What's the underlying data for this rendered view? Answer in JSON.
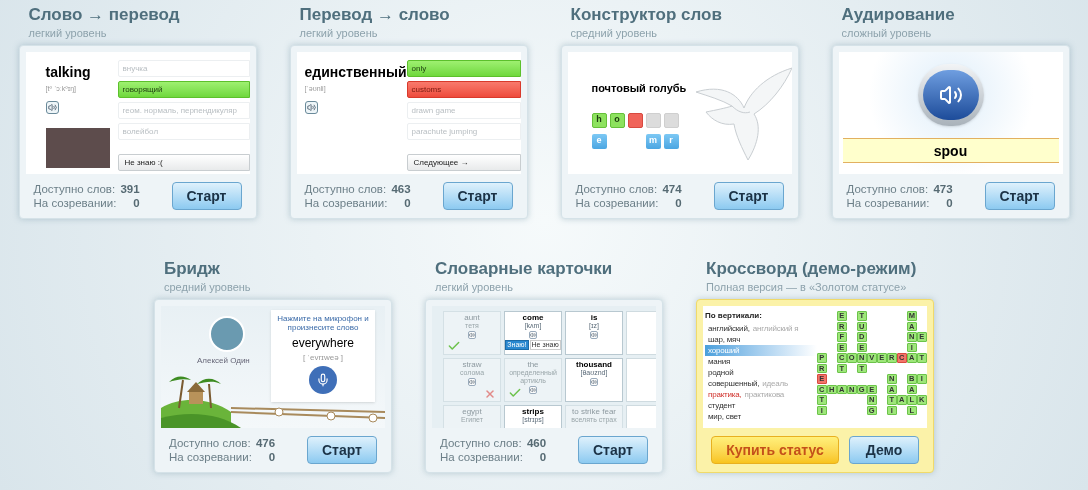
{
  "rows": [
    {
      "cards": [
        {
          "kind": "translate",
          "title": "Слово → перевод",
          "subtitle": "легкий уровень",
          "featured": false,
          "preview": {
            "word": "talking",
            "transcription": "[tº ˈɔːkºɪŋ]",
            "options": [
              {
                "text": "внучка",
                "correct": false,
                "wrong": false
              },
              {
                "text": "говорящий",
                "correct": true,
                "wrong": false
              },
              {
                "text": "геом. нормаль, перпендикуляр",
                "correct": false,
                "wrong": false
              },
              {
                "text": "волейбол",
                "correct": false,
                "wrong": false
              }
            ],
            "action": "Не знаю :("
          },
          "stats": [
            {
              "label": "Доступно слов:",
              "value": "391"
            },
            {
              "label": "На созревании:",
              "value": "0"
            }
          ],
          "buttons": [
            {
              "kind": "start",
              "label": "Старт"
            }
          ]
        },
        {
          "kind": "reverse",
          "title": "Перевод → слово",
          "subtitle": "легкий уровень",
          "featured": false,
          "preview": {
            "word": "единственный",
            "transcription": "[ˈəʊnli]",
            "options": [
              {
                "text": "only",
                "correct": true,
                "wrong": false
              },
              {
                "text": "customs",
                "correct": false,
                "wrong": true
              },
              {
                "text": "drawn game",
                "correct": false,
                "wrong": false
              },
              {
                "text": "parachute jumping",
                "correct": false,
                "wrong": false
              }
            ],
            "action": "Следующее →"
          },
          "stats": [
            {
              "label": "Доступно слов:",
              "value": "463"
            },
            {
              "label": "На созревании:",
              "value": "0"
            }
          ],
          "buttons": [
            {
              "kind": "start",
              "label": "Старт"
            }
          ]
        },
        {
          "kind": "constructor",
          "title": "Конструктор слов",
          "subtitle": "средний уровень",
          "featured": false,
          "preview": {
            "word": "почтовый голубь",
            "slots": [
              {
                "letter": "h",
                "correct": true,
                "wrong": false
              },
              {
                "letter": "o",
                "correct": true,
                "wrong": false
              },
              {
                "correct": false,
                "wrong": true
              },
              {
                "correct": false,
                "wrong": false
              },
              {
                "correct": false,
                "wrong": false
              }
            ],
            "tiles": [
              {
                "letter": "e",
                "used": false
              },
              {
                "used": true
              },
              {
                "used": true
              },
              {
                "letter": "m",
                "used": false
              },
              {
                "letter": "r",
                "used": false
              }
            ]
          },
          "stats": [
            {
              "label": "Доступно слов:",
              "value": "474"
            },
            {
              "label": "На созревании:",
              "value": "0"
            }
          ],
          "buttons": [
            {
              "kind": "start",
              "label": "Старт"
            }
          ]
        },
        {
          "kind": "listening",
          "title": "Аудирование",
          "subtitle": "сложный уровень",
          "featured": false,
          "preview": {
            "typed": "spou"
          },
          "stats": [
            {
              "label": "Доступно слов:",
              "value": "473"
            },
            {
              "label": "На созревании:",
              "value": "0"
            }
          ],
          "buttons": [
            {
              "kind": "start",
              "label": "Старт"
            }
          ]
        }
      ]
    },
    {
      "cards": [
        {
          "kind": "bridge",
          "title": "Бридж",
          "subtitle": "средний уровень",
          "featured": false,
          "preview": {
            "name": "Алексей Один",
            "prompt": "Нажмите на микрофон и произнесите слово",
            "word": "everywhere",
            "transcription": "[ ˈevrɪweə ]"
          },
          "stats": [
            {
              "label": "Доступно слов:",
              "value": "476"
            },
            {
              "label": "На созревании:",
              "value": "0"
            }
          ],
          "buttons": [
            {
              "kind": "start",
              "label": "Старт"
            }
          ]
        },
        {
          "kind": "flashcards",
          "title": "Словарные карточки",
          "subtitle": "легкий уровень",
          "featured": false,
          "preview": {
            "cards": [
              {
                "kind": "word",
                "word": "aunt",
                "hint": "тетя",
                "faded": true,
                "audio": true,
                "checked": true,
                "crossed": false
              },
              {
                "kind": "word",
                "word": "come",
                "hint": "[kʌm]",
                "faded": false,
                "audio": true,
                "checked": false,
                "crossed": false,
                "answers": [
                  {
                    "text": "Знаю!",
                    "selected": true
                  },
                  {
                    "text": "Не знаю",
                    "selected": false
                  }
                ]
              },
              {
                "kind": "word",
                "word": "is",
                "hint": "[ɪz]",
                "faded": false,
                "audio": true,
                "checked": false,
                "crossed": false
              },
              {
                "kind": "blank"
              },
              {
                "kind": "word",
                "word": "straw",
                "hint": "солома",
                "faded": true,
                "audio": true,
                "checked": false,
                "crossed": true
              },
              {
                "kind": "word",
                "word": "the",
                "hint": "определенный артикль",
                "faded": true,
                "audio": true,
                "checked": true,
                "crossed": false
              },
              {
                "kind": "word",
                "word": "thousand",
                "hint": "[θaʊznd]",
                "faded": false,
                "audio": true,
                "checked": false,
                "crossed": false
              },
              {
                "kind": "blank"
              },
              {
                "kind": "word",
                "word": "egypt",
                "hint": "Египет",
                "faded": true,
                "audio": false,
                "checked": false,
                "crossed": false
              },
              {
                "kind": "word",
                "word": "strips",
                "hint": "[strɪps]",
                "faded": false,
                "audio": false,
                "checked": false,
                "crossed": false
              },
              {
                "kind": "word",
                "word": "to strike fear",
                "hint": "вселять страх",
                "faded": true,
                "audio": false,
                "checked": false,
                "crossed": false
              },
              {
                "kind": "blank"
              }
            ]
          },
          "stats": [
            {
              "label": "Доступно слов:",
              "value": "460"
            },
            {
              "label": "На созревании:",
              "value": "0"
            }
          ],
          "buttons": [
            {
              "kind": "start",
              "label": "Старт"
            }
          ]
        },
        {
          "kind": "crossword",
          "title": "Кроссворд (демо-режим)",
          "subtitle": "Полная версия — в «Золотом статусе»",
          "featured": true,
          "preview": {
            "heading": "По вертикали:",
            "clues": [
              {
                "text": "английский,",
                "extra": "английский я",
                "selected": false,
                "wrong": false
              },
              {
                "text": "шар, мяч",
                "selected": false,
                "wrong": false
              },
              {
                "text": "хороший",
                "selected": true,
                "wrong": false
              },
              {
                "text": "мания",
                "selected": false,
                "wrong": false
              },
              {
                "text": "родной",
                "selected": false,
                "wrong": false
              },
              {
                "text": "совершенный,",
                "extra": "идеаль",
                "selected": false,
                "wrong": false
              },
              {
                "text": "практика,",
                "extra": "практикова",
                "selected": false,
                "wrong": true
              },
              {
                "text": "студент",
                "selected": false,
                "wrong": false
              },
              {
                "text": "мир, свет",
                "selected": false,
                "wrong": false
              }
            ],
            "grid": [
              [
                {
                  "kind": "empty"
                },
                {
                  "kind": "empty"
                },
                {
                  "kind": "letter",
                  "letter": "E",
                  "wrong": false
                },
                {
                  "kind": "empty"
                },
                {
                  "kind": "letter",
                  "letter": "T",
                  "wrong": false
                },
                {
                  "kind": "empty"
                },
                {
                  "kind": "empty"
                },
                {
                  "kind": "empty"
                },
                {
                  "kind": "empty"
                },
                {
                  "kind": "letter",
                  "letter": "M",
                  "wrong": false
                },
                {
                  "kind": "empty"
                }
              ],
              [
                {
                  "kind": "empty"
                },
                {
                  "kind": "empty"
                },
                {
                  "kind": "letter",
                  "letter": "R",
                  "wrong": false
                },
                {
                  "kind": "empty"
                },
                {
                  "kind": "letter",
                  "letter": "U",
                  "wrong": false
                },
                {
                  "kind": "empty"
                },
                {
                  "kind": "empty"
                },
                {
                  "kind": "empty"
                },
                {
                  "kind": "empty"
                },
                {
                  "kind": "letter",
                  "letter": "A",
                  "wrong": false
                },
                {
                  "kind": "empty"
                }
              ],
              [
                {
                  "kind": "empty"
                },
                {
                  "kind": "empty"
                },
                {
                  "kind": "letter",
                  "letter": "F",
                  "wrong": false
                },
                {
                  "kind": "empty"
                },
                {
                  "kind": "letter",
                  "letter": "D",
                  "wrong": false
                },
                {
                  "kind": "empty"
                },
                {
                  "kind": "empty"
                },
                {
                  "kind": "empty"
                },
                {
                  "kind": "empty"
                },
                {
                  "kind": "letter",
                  "letter": "N",
                  "wrong": false
                },
                {
                  "kind": "letter",
                  "letter": "E",
                  "wrong": false
                }
              ],
              [
                {
                  "kind": "empty"
                },
                {
                  "kind": "empty"
                },
                {
                  "kind": "letter",
                  "letter": "E",
                  "wrong": false
                },
                {
                  "kind": "empty"
                },
                {
                  "kind": "letter",
                  "letter": "E",
                  "wrong": false
                },
                {
                  "kind": "empty"
                },
                {
                  "kind": "empty"
                },
                {
                  "kind": "empty"
                },
                {
                  "kind": "empty"
                },
                {
                  "kind": "letter",
                  "letter": "I",
                  "wrong": false
                },
                {
                  "kind": "empty"
                }
              ],
              [
                {
                  "kind": "letter",
                  "letter": "P",
                  "wrong": false
                },
                {
                  "kind": "empty"
                },
                {
                  "kind": "letter",
                  "letter": "C",
                  "wrong": false
                },
                {
                  "kind": "letter",
                  "letter": "O",
                  "wrong": false
                },
                {
                  "kind": "letter",
                  "letter": "N",
                  "wrong": false
                },
                {
                  "kind": "letter",
                  "letter": "V",
                  "wrong": false
                },
                {
                  "kind": "letter",
                  "letter": "E",
                  "wrong": false
                },
                {
                  "kind": "letter",
                  "letter": "R",
                  "wrong": false
                },
                {
                  "kind": "letter",
                  "letter": "C",
                  "wrong": true
                },
                {
                  "kind": "letter",
                  "letter": "A",
                  "wrong": false
                },
                {
                  "kind": "letter",
                  "letter": "T",
                  "wrong": false
                }
              ],
              [
                {
                  "kind": "letter",
                  "letter": "R",
                  "wrong": false
                },
                {
                  "kind": "empty"
                },
                {
                  "kind": "letter",
                  "letter": "T",
                  "wrong": false
                },
                {
                  "kind": "empty"
                },
                {
                  "kind": "letter",
                  "letter": "T",
                  "wrong": false
                },
                {
                  "kind": "empty"
                },
                {
                  "kind": "empty"
                },
                {
                  "kind": "empty"
                },
                {
                  "kind": "empty"
                },
                {
                  "kind": "empty"
                },
                {
                  "kind": "empty"
                }
              ],
              [
                {
                  "kind": "letter",
                  "letter": "E",
                  "wrong": true
                },
                {
                  "kind": "empty"
                },
                {
                  "kind": "empty"
                },
                {
                  "kind": "empty"
                },
                {
                  "kind": "empty"
                },
                {
                  "kind": "empty"
                },
                {
                  "kind": "empty"
                },
                {
                  "kind": "letter",
                  "letter": "N",
                  "wrong": false
                },
                {
                  "kind": "empty"
                },
                {
                  "kind": "letter",
                  "letter": "B",
                  "wrong": false
                },
                {
                  "kind": "letter",
                  "letter": "I",
                  "wrong": false
                }
              ],
              [
                {
                  "kind": "letter",
                  "letter": "C",
                  "wrong": false
                },
                {
                  "kind": "letter",
                  "letter": "H",
                  "wrong": false
                },
                {
                  "kind": "letter",
                  "letter": "A",
                  "wrong": false
                },
                {
                  "kind": "letter",
                  "letter": "N",
                  "wrong": false
                },
                {
                  "kind": "letter",
                  "letter": "G",
                  "wrong": false
                },
                {
                  "kind": "letter",
                  "letter": "E",
                  "wrong": false
                },
                {
                  "kind": "empty"
                },
                {
                  "kind": "letter",
                  "letter": "A",
                  "wrong": false
                },
                {
                  "kind": "empty"
                },
                {
                  "kind": "letter",
                  "letter": "A",
                  "wrong": false
                },
                {
                  "kind": "empty"
                }
              ],
              [
                {
                  "kind": "letter",
                  "letter": "T",
                  "wrong": false
                },
                {
                  "kind": "empty"
                },
                {
                  "kind": "empty"
                },
                {
                  "kind": "empty"
                },
                {
                  "kind": "empty"
                },
                {
                  "kind": "letter",
                  "letter": "N",
                  "wrong": false
                },
                {
                  "kind": "empty"
                },
                {
                  "kind": "letter",
                  "letter": "T",
                  "wrong": false
                },
                {
                  "kind": "letter",
                  "letter": "A",
                  "wrong": false
                },
                {
                  "kind": "letter",
                  "letter": "L",
                  "wrong": false
                },
                {
                  "kind": "letter",
                  "letter": "K",
                  "wrong": false
                }
              ],
              [
                {
                  "kind": "letter",
                  "letter": "I",
                  "wrong": false
                },
                {
                  "kind": "empty"
                },
                {
                  "kind": "empty"
                },
                {
                  "kind": "empty"
                },
                {
                  "kind": "empty"
                },
                {
                  "kind": "letter",
                  "letter": "G",
                  "wrong": false
                },
                {
                  "kind": "empty"
                },
                {
                  "kind": "letter",
                  "letter": "I",
                  "wrong": false
                },
                {
                  "kind": "empty"
                },
                {
                  "kind": "letter",
                  "letter": "L",
                  "wrong": false
                },
                {
                  "kind": "empty"
                }
              ]
            ]
          },
          "buttons": [
            {
              "kind": "buy",
              "label": "Купить статус"
            },
            {
              "kind": "demo",
              "label": "Демо"
            }
          ]
        }
      ]
    }
  ]
}
